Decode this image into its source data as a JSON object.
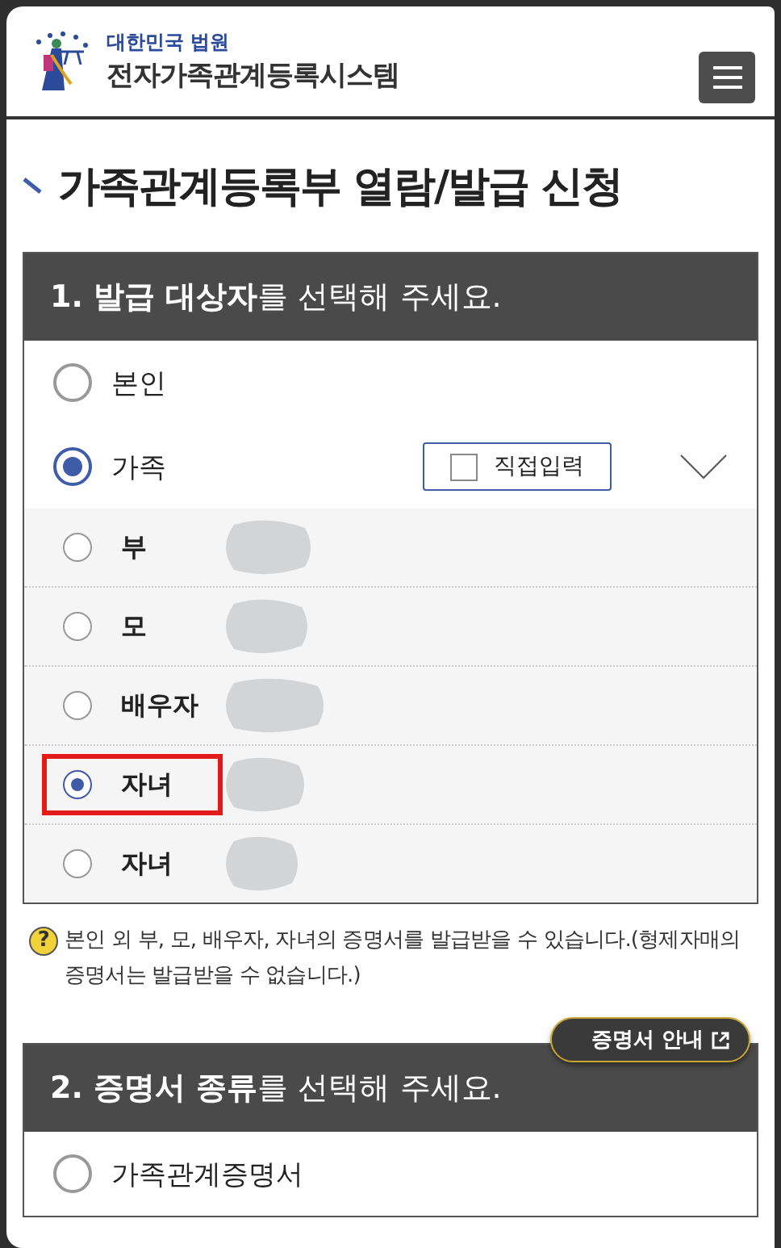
{
  "header": {
    "org": "대한민국 법원",
    "system": "전자가족관계등록시스템"
  },
  "page_title": "가족관계등록부 열람/발급 신청",
  "section1": {
    "heading": "**1. 발급 대상자**를 선택해 주세요.",
    "options": [
      {
        "label": "본인",
        "selected": false
      },
      {
        "label": "가족",
        "selected": true
      }
    ],
    "direct_input": {
      "label": "직접입력",
      "checked": false
    },
    "expanded": true,
    "members": [
      {
        "label": "부",
        "selected": false,
        "redacted": true,
        "highlighted": false
      },
      {
        "label": "모",
        "selected": false,
        "redacted": true,
        "highlighted": false
      },
      {
        "label": "배우자",
        "selected": false,
        "redacted": true,
        "highlighted": false
      },
      {
        "label": "자녀",
        "selected": true,
        "redacted": true,
        "highlighted": true
      },
      {
        "label": "자녀",
        "selected": false,
        "redacted": true,
        "highlighted": false
      }
    ]
  },
  "note": {
    "icon": "?",
    "text": "본인 외 부, 모, 배우자, 자녀의 증명서를 발급받을 수 있습니다.(형제자매의 증명서는 발급받을 수 없습니다.)"
  },
  "guide_button": "증명서 안내",
  "section2": {
    "heading": "**2. 증명서 종류**를 선택해 주세요.",
    "options": [
      {
        "label": "가족관계증명서",
        "selected": false
      }
    ]
  }
}
